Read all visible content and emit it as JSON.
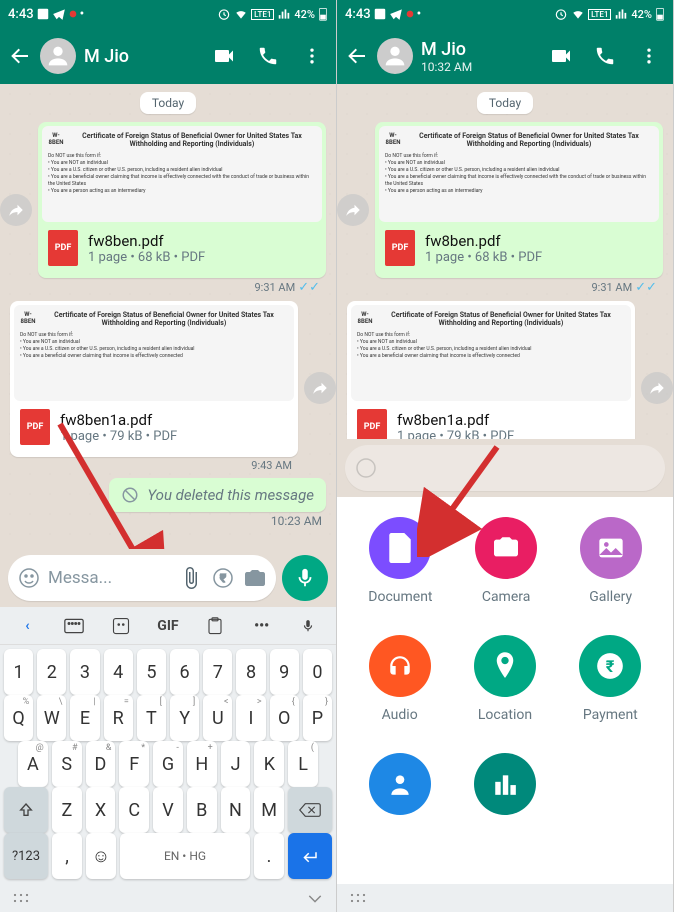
{
  "status": {
    "time": "4:43",
    "battery": "42%",
    "net": "LTE1"
  },
  "contact": {
    "name": "M Jio",
    "time": "10:32 AM"
  },
  "date_label": "Today",
  "msg1": {
    "form": "W-8BEN",
    "title": "Certificate of Foreign Status of Beneficial Owner for United States Tax Withholding and Reporting (Individuals)",
    "file": "fw8ben.pdf",
    "meta": "1 page • 68 kB • PDF",
    "time": "9:31 AM"
  },
  "msg2": {
    "form": "W-8BEN",
    "title": "Certificate of Foreign Status of Beneficial Owner for United States Tax Withholding and Reporting (Individuals)",
    "file": "fw8ben1a.pdf",
    "meta": "1 page • 79 kB • PDF",
    "time": "9:43 AM"
  },
  "deleted": {
    "text": "You deleted this message",
    "time": "10:23 AM"
  },
  "input": {
    "placeholder": "Messa..."
  },
  "kb": {
    "lang": "EN • HG",
    "sym": "?123",
    "gif": "GIF"
  },
  "attach": {
    "doc": "Document",
    "cam": "Camera",
    "gal": "Gallery",
    "aud": "Audio",
    "loc": "Location",
    "pay": "Payment"
  },
  "pdf_label": "PDF",
  "digits": [
    "1",
    "2",
    "3",
    "4",
    "5",
    "6",
    "7",
    "8",
    "9",
    "0"
  ],
  "r1": [
    "Q",
    "W",
    "E",
    "R",
    "T",
    "Y",
    "U",
    "I",
    "O",
    "P"
  ],
  "r1s": [
    "%",
    "\\",
    "|",
    "=",
    "[",
    "]",
    "<",
    ">",
    "{",
    "}"
  ],
  "r2": [
    "A",
    "S",
    "D",
    "F",
    "G",
    "H",
    "J",
    "K",
    "L"
  ],
  "r2s": [
    "@",
    "#",
    "&",
    "*",
    "-",
    "+",
    "",
    "",
    "("
  ],
  "r3": [
    "Z",
    "X",
    "C",
    "V",
    "B",
    "N",
    "M"
  ]
}
